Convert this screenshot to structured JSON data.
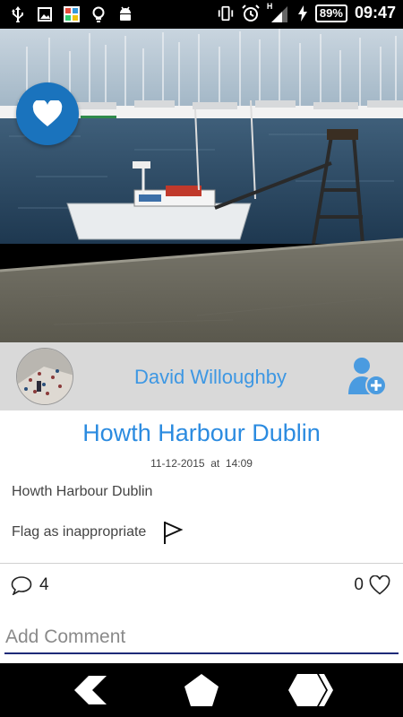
{
  "status_bar": {
    "battery": "89%",
    "network": "H",
    "time": "09:47",
    "icons": [
      "usb-icon",
      "gallery-icon",
      "app-notification-icon",
      "bulb-icon",
      "android-icon",
      "vibrate-icon",
      "alarm-icon",
      "signal-icon",
      "charging-icon",
      "battery-icon"
    ]
  },
  "photo": {
    "favorite_icon": "heart-icon",
    "accent": "#1a73bd"
  },
  "user": {
    "name": "David Willoughby",
    "add_icon": "add-user-icon",
    "color": "#3d97e3"
  },
  "post": {
    "title": "Howth Harbour Dublin",
    "date": "11-12-2015  at  14:09",
    "description": "Howth Harbour Dublin",
    "flag_label": "Flag as inappropriate",
    "comment_count": "4",
    "like_count": "0"
  },
  "comment": {
    "placeholder": "Add Comment"
  },
  "nav": {
    "back_icon": "back-icon",
    "home_icon": "home-icon",
    "recents_icon": "recents-icon"
  }
}
